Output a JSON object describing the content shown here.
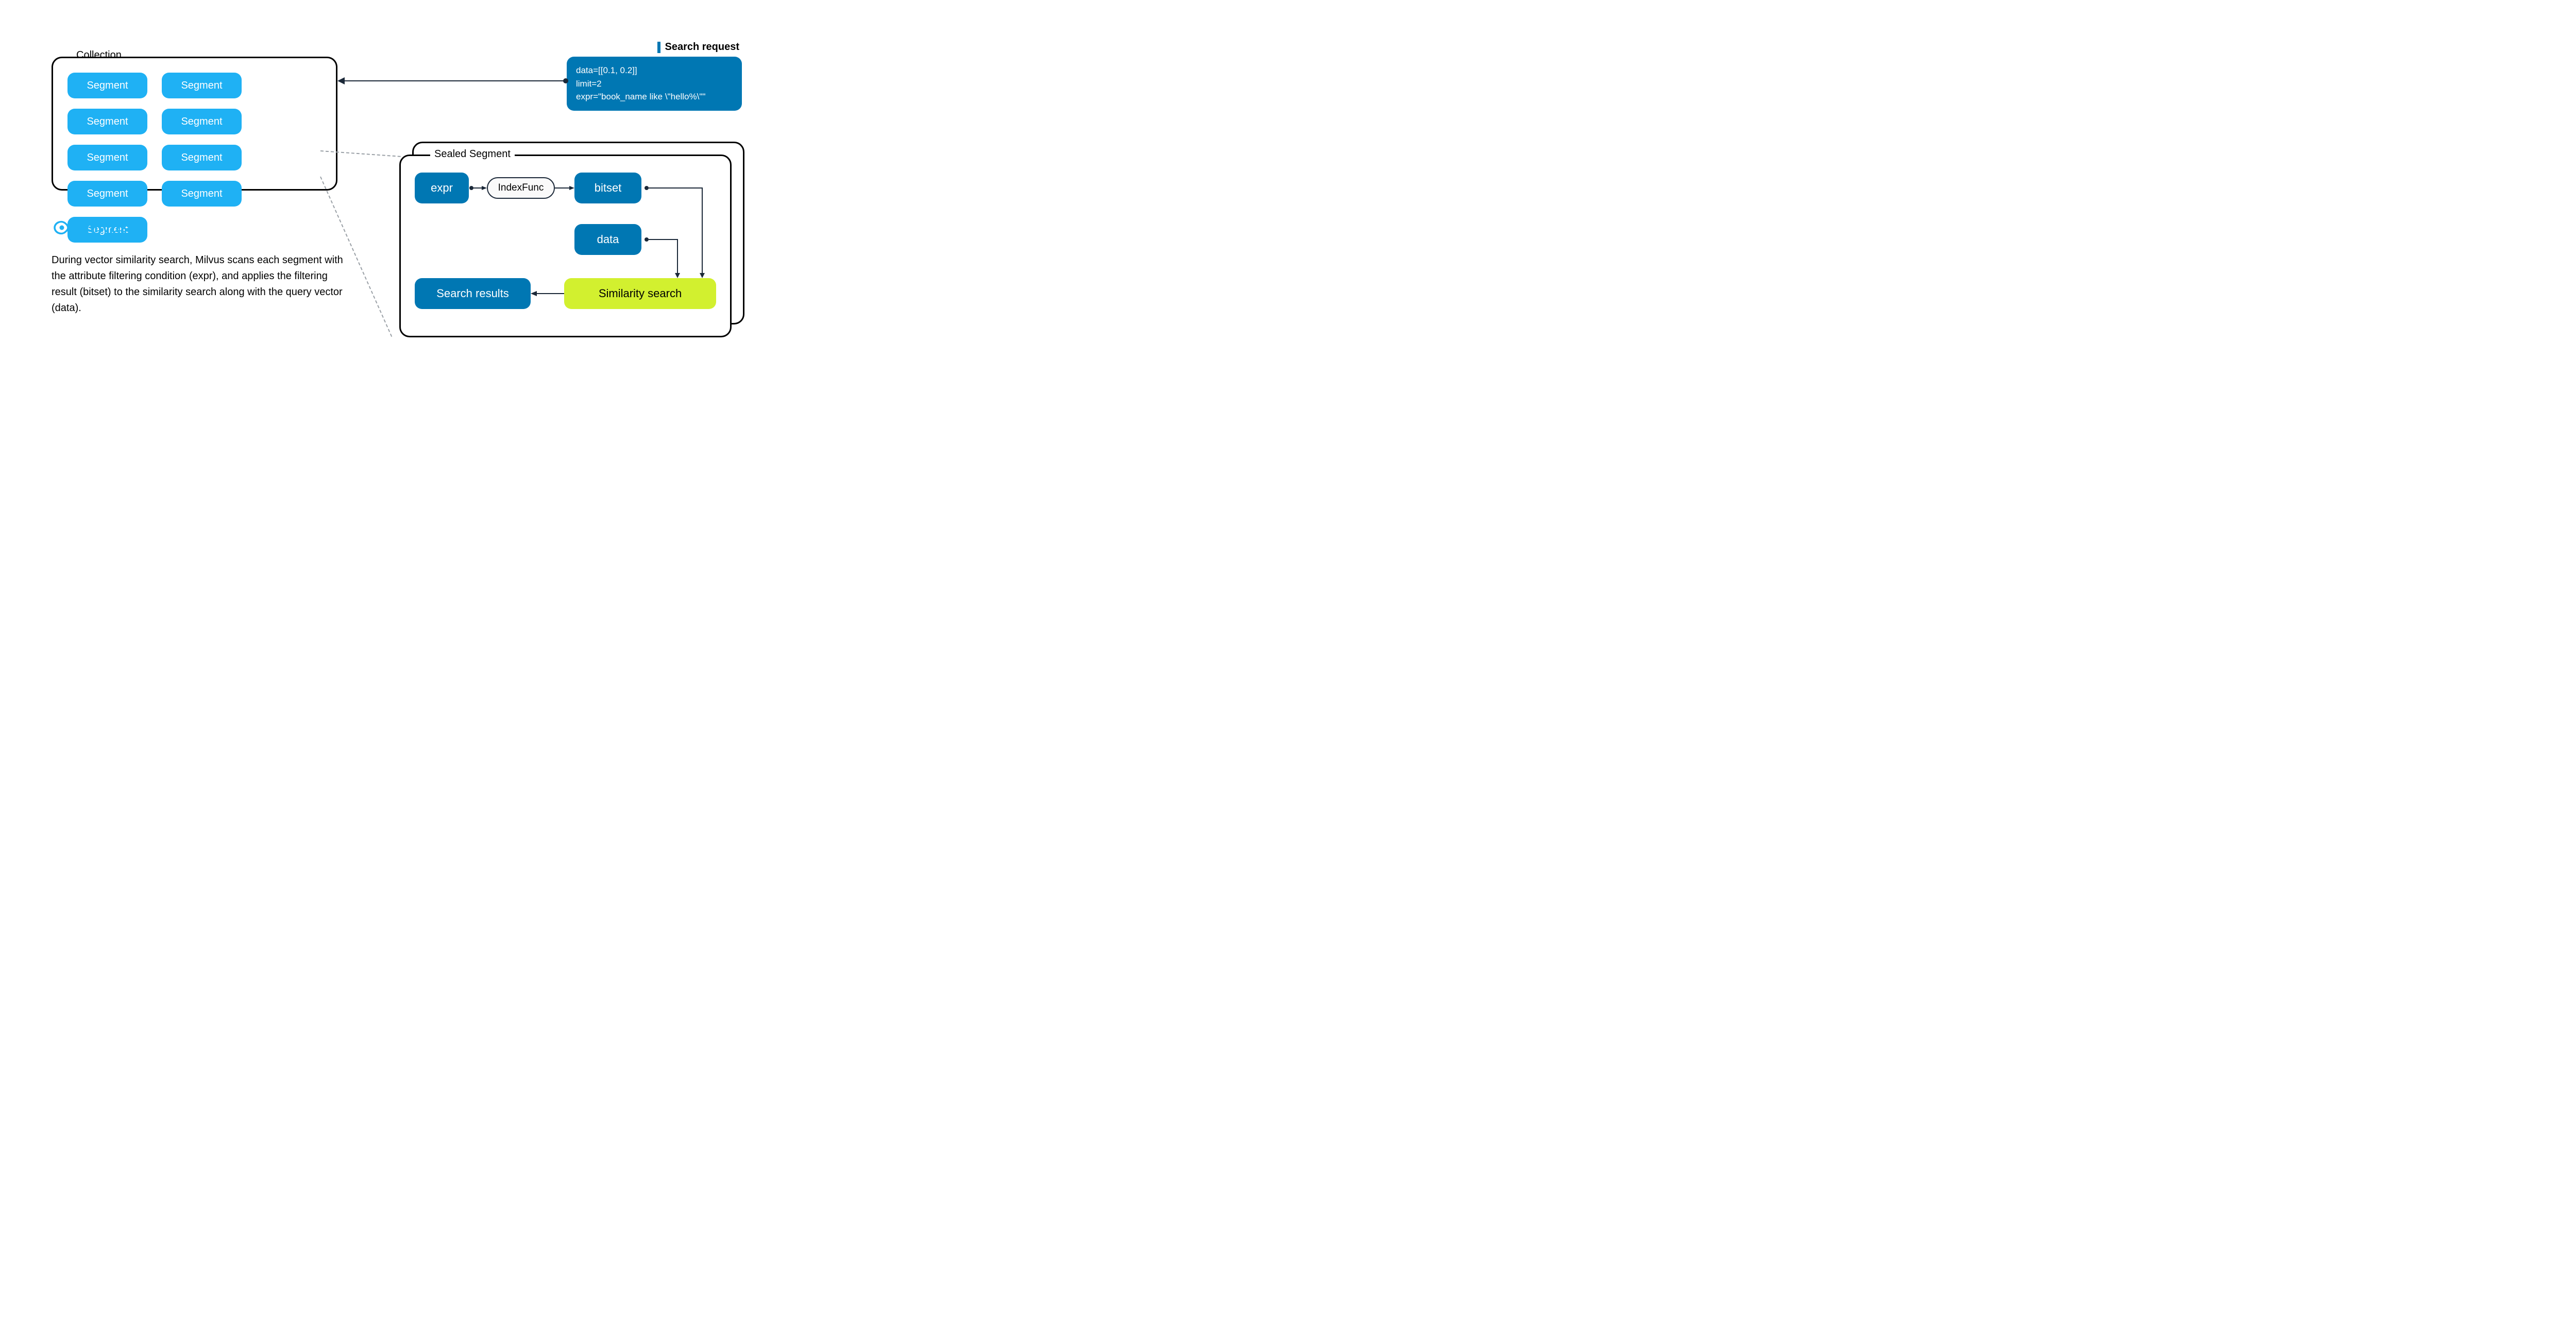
{
  "collection": {
    "label": "Collection",
    "segments": [
      "Segment",
      "Segment",
      "Segment",
      "Segment",
      "Segment",
      "Segment",
      "Segment",
      "Segment",
      "Segment"
    ]
  },
  "search_request": {
    "label": "Search request",
    "line1": "data=[[0.1, 0.2]]",
    "line2": "limit=2",
    "line3": "expr=\"book_name like \\\"hello%\\\"\""
  },
  "sealed_segment": {
    "label": "Sealed Segment",
    "expr": "expr",
    "index_func": "IndexFunc",
    "bitset": "bitset",
    "data": "data",
    "search_results": "Search results",
    "similarity_search": "Similarity search"
  },
  "logo": {
    "name": "milvus"
  },
  "description": "During vector similarity search, Milvus scans each segment with the attribute filtering condition (expr), and applies the filtering result (bitset) to the similarity search along with the query vector (data).",
  "colors": {
    "light_blue": "#1fb1f4",
    "dark_blue": "#0077b3",
    "green": "#d2f02f",
    "dark": "#1b2838"
  }
}
